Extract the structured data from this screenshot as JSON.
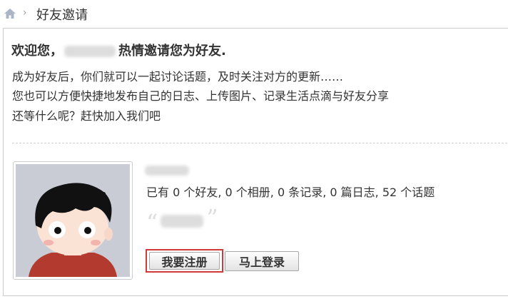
{
  "breadcrumb": {
    "home_icon": "home-icon",
    "separator": "›",
    "current": "好友邀请"
  },
  "invite": {
    "welcome_prefix": "欢迎您，",
    "welcome_suffix": "热情邀请您为好友.",
    "line1": "成为好友后，你们就可以一起讨论话题，及时关注对方的更新……",
    "line2": "您也可以方便快捷地发布自己的日志、上传图片、记录生活点滴与好友分享",
    "line3": "还等什么呢？赶快加入我们吧"
  },
  "profile": {
    "stats": "已有 0 个好友, 0 个相册, 0 条记录, 0 篇日志, 52 个话题",
    "quote_open": "“",
    "quote_close": "”"
  },
  "buttons": {
    "register": "我要注册",
    "login": "马上登录"
  },
  "colors": {
    "highlight_border": "#d13a3a",
    "home_icon": "#aab6c6"
  }
}
